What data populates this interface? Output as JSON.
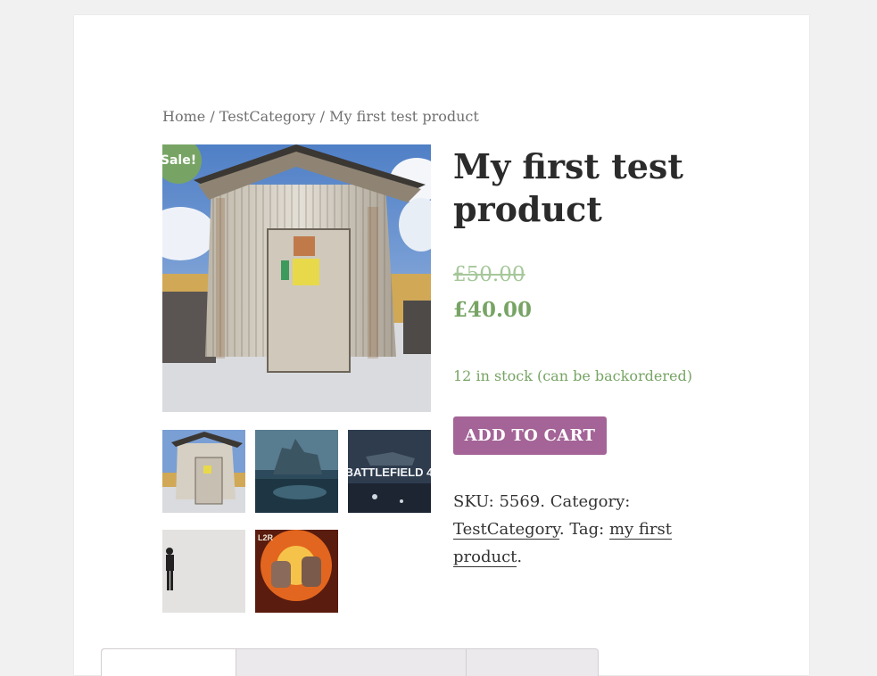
{
  "breadcrumb": {
    "home": "Home",
    "sep1": " / ",
    "category": "TestCategory",
    "sep2": " / ",
    "current": "My first test product"
  },
  "product": {
    "title": "My first test product",
    "sale_badge": "Sale!",
    "price_old": "£50.00",
    "price_new": "£40.00",
    "stock": "12 in stock (can be backordered)",
    "add_to_cart": "ADD TO CART",
    "sku_label": "SKU: ",
    "sku": "5569",
    "category_label": ". Category: ",
    "category": "TestCategory",
    "tag_label": ". Tag: ",
    "tag": "my first product",
    "end": "."
  },
  "thumbs": [
    {
      "name": "shed"
    },
    {
      "name": "ocean-city"
    },
    {
      "name": "battlefield-4",
      "text": "BATTLEFIELD 4"
    },
    {
      "name": "figure"
    },
    {
      "name": "l2r-robots",
      "text": "L2R"
    }
  ],
  "colors": {
    "sale_green": "#77a464",
    "button_purple": "#a46497",
    "old_price": "#a6c79a"
  }
}
